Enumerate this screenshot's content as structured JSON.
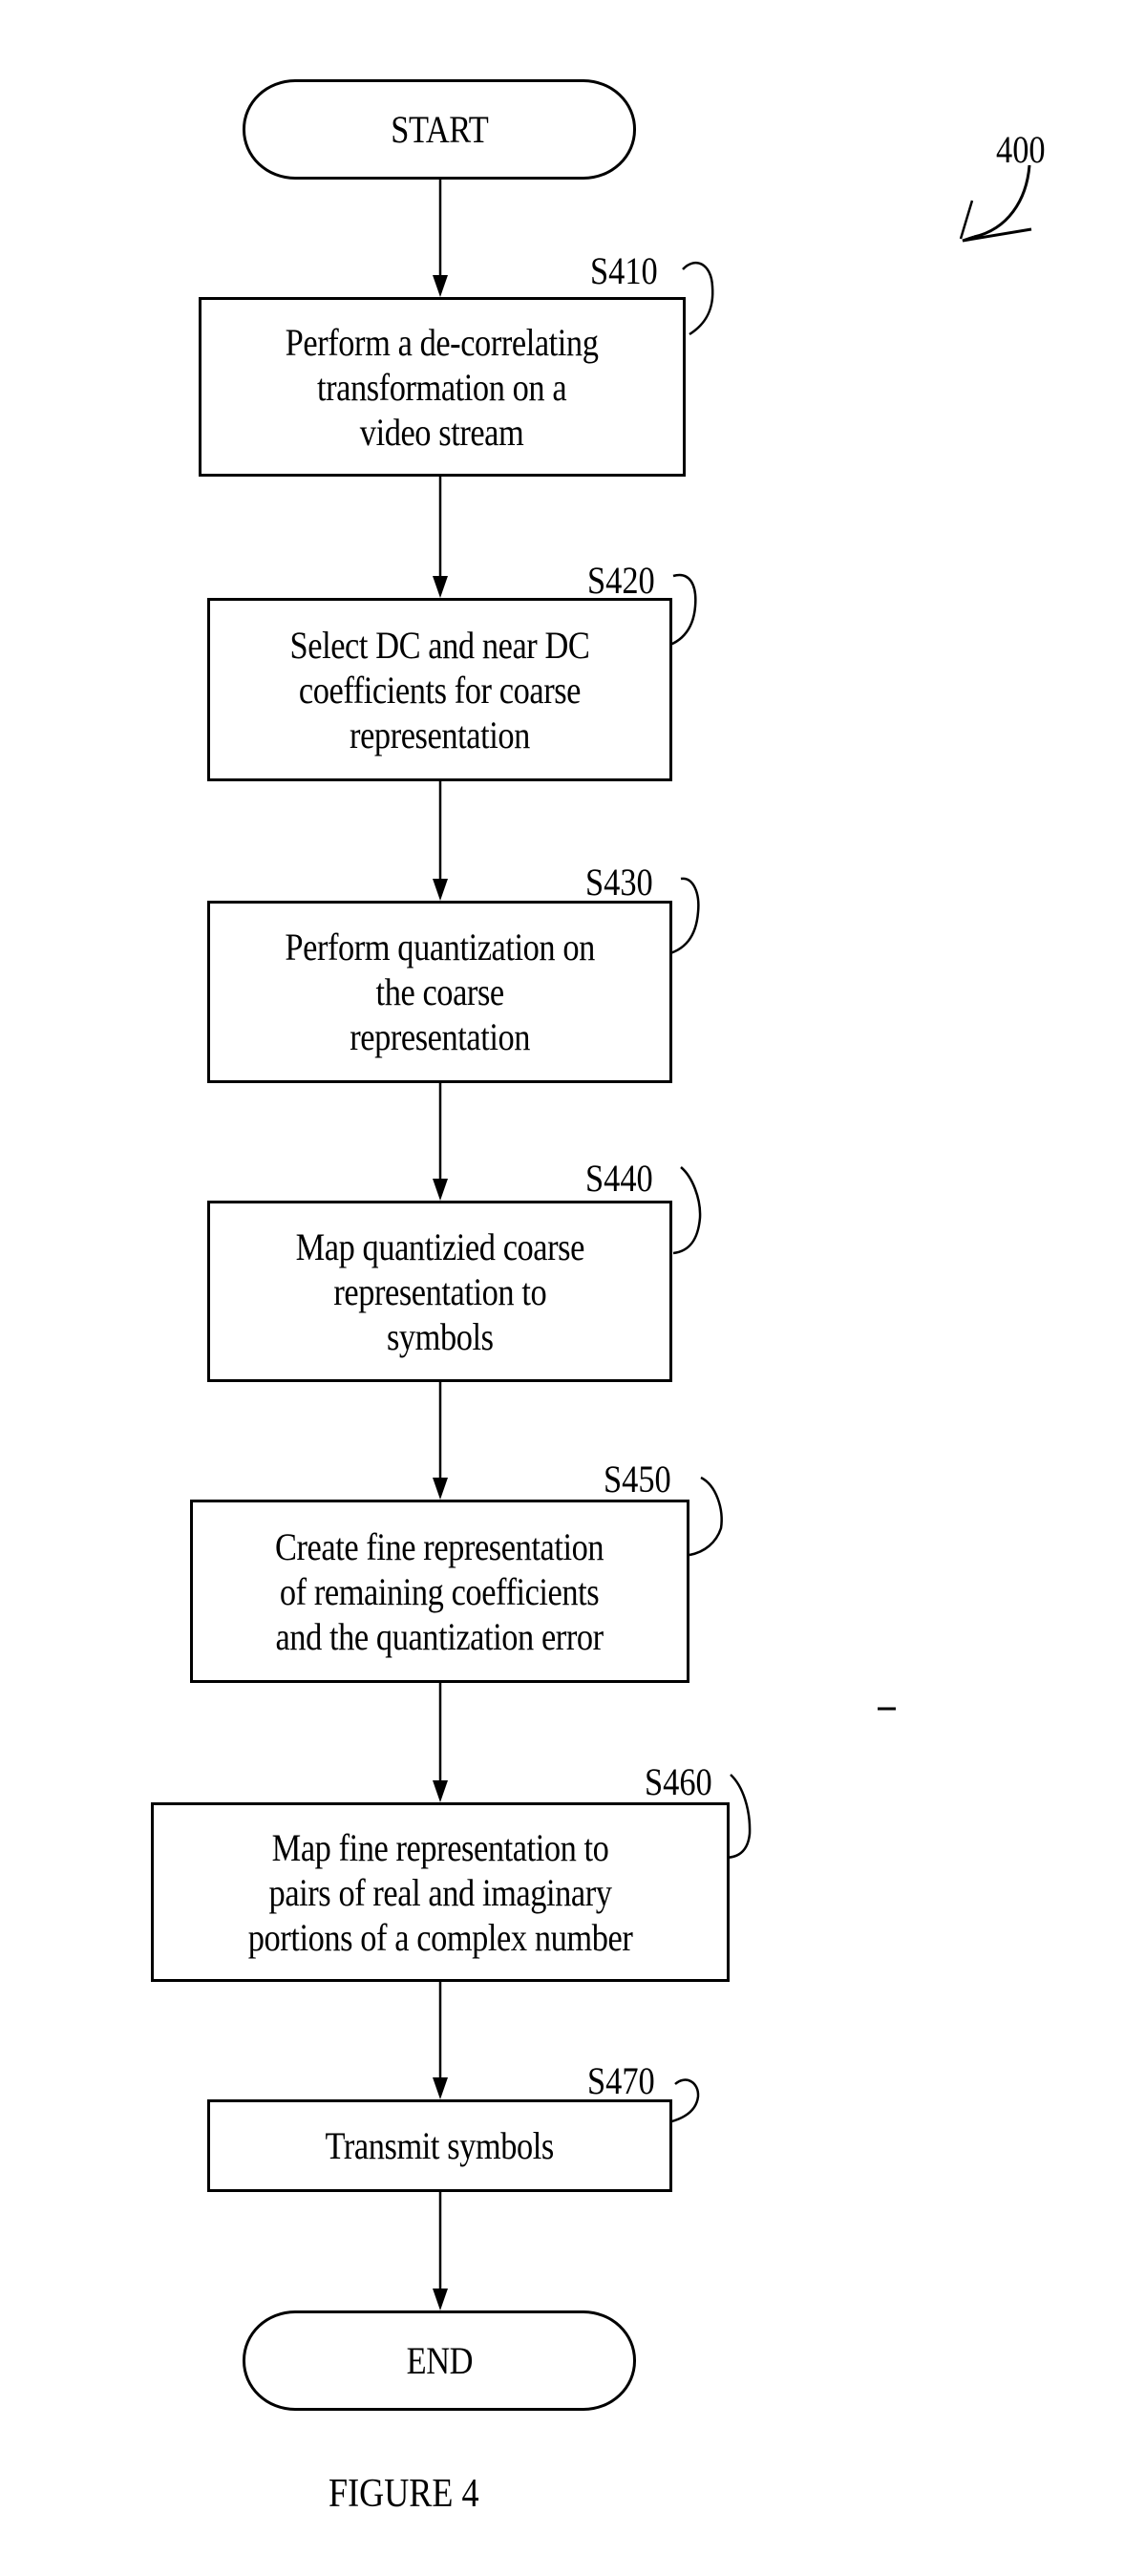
{
  "figure": {
    "reference_number": "400",
    "caption": "FIGURE 4"
  },
  "terminals": {
    "start": "START",
    "end": "END"
  },
  "steps": [
    {
      "id": "S410",
      "text": "Perform a de-correlating\ntransformation on a\nvideo stream"
    },
    {
      "id": "S420",
      "text": "Select DC and near DC\ncoefficients for coarse\nrepresentation"
    },
    {
      "id": "S430",
      "text": "Perform quantization on\nthe coarse\nrepresentation"
    },
    {
      "id": "S440",
      "text": "Map quantizied coarse\nrepresentation to\nsymbols"
    },
    {
      "id": "S450",
      "text": "Create fine representation\nof remaining coefficients\nand the quantization error"
    },
    {
      "id": "S460",
      "text": "Map fine representation to\npairs of real and imaginary\nportions of a complex number"
    },
    {
      "id": "S470",
      "text": "Transmit symbols"
    }
  ]
}
